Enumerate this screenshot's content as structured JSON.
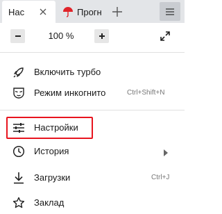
{
  "tabs": [
    {
      "label": "Нас",
      "active": true,
      "has_close": true
    },
    {
      "label": "Прогн",
      "active": false,
      "favicon": "umbrella-icon"
    }
  ],
  "toolbar": {
    "new_tab_icon": "plus-icon",
    "menu_icon": "hamburger-icon"
  },
  "zoom": {
    "minus_label": "−",
    "value": "100 %",
    "plus_label": "+",
    "fullscreen_icon": "fullscreen-arrows-icon"
  },
  "menu": {
    "items": [
      {
        "label": "Включить турбо",
        "icon": "rocket-icon",
        "shortcut": ""
      },
      {
        "label": "Режим инкогнито",
        "icon": "incognito-mask-icon",
        "shortcut": "Ctrl+Shift+N"
      },
      {
        "label": "Настройки",
        "icon": "settings-sliders-icon",
        "shortcut": "",
        "highlighted": true
      },
      {
        "label": "История",
        "icon": "clock-icon",
        "shortcut": "",
        "has_submenu": true
      },
      {
        "label": "Загрузки",
        "icon": "download-icon",
        "shortcut": "Ctrl+J"
      },
      {
        "label": "Заклад",
        "icon": "star-icon",
        "shortcut": ""
      }
    ]
  },
  "colors": {
    "highlight": "#e8141e",
    "tab_bar": "#e3e5e8",
    "umbrella": "#e0242a"
  }
}
